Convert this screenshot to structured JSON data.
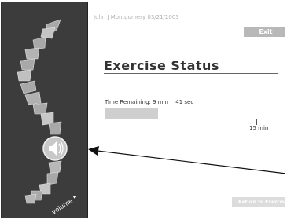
{
  "header": {
    "user_name": "John J Montgomery",
    "date": "03/21/2003",
    "exit_label": "Exit"
  },
  "main": {
    "title": "Exercise Status",
    "time_remaining_label": "Time Remaining:",
    "minutes": "9 min",
    "seconds": "41 sec",
    "max_label": "15 min",
    "progress_fraction": 0.35
  },
  "footer": {
    "return_label": "Return to Exercise"
  },
  "sidebar": {
    "volume_label": "volume",
    "volume_icon": "speaker-icon",
    "chevron_icon": "chevron-down-icon"
  },
  "colors": {
    "sidebar_bg": "#3c3c3c",
    "exit_bg": "#b8b8b8",
    "progress_fill": "#cfcfcf"
  }
}
